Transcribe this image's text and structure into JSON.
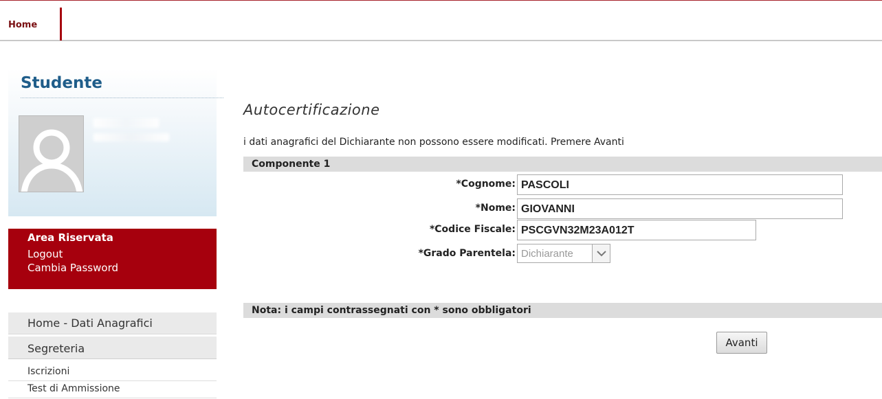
{
  "topnav": {
    "home_label": "Home"
  },
  "sidebar": {
    "title": "Studente",
    "area": {
      "title": "Area Riservata",
      "logout": "Logout",
      "change_password": "Cambia Password"
    },
    "nav": [
      "Home - Dati Anagrafici",
      "Segreteria"
    ],
    "subnav": [
      "Iscrizioni",
      "Test di Ammissione"
    ]
  },
  "main": {
    "title": "Autocertificazione",
    "intro": "i dati anagrafici del Dichiarante non possono essere modificati. Premere Avanti",
    "component_header": "Componente 1",
    "fields": {
      "cognome": {
        "label": "*Cognome:",
        "value": "PASCOLI"
      },
      "nome": {
        "label": "*Nome:",
        "value": "GIOVANNI"
      },
      "codice_fiscale": {
        "label": "*Codice Fiscale:",
        "value": "PSCGVN32M23A012T"
      },
      "grado_parentela": {
        "label": "*Grado Parentela:",
        "value": "Dichiarante"
      }
    },
    "nota": "Nota: i campi contrassegnati con * sono obbligatori",
    "next_button": "Avanti"
  },
  "colors": {
    "brand_red": "#a6000d",
    "title_blue": "#1f5d8a",
    "bar_gray": "#dcdcdc"
  }
}
